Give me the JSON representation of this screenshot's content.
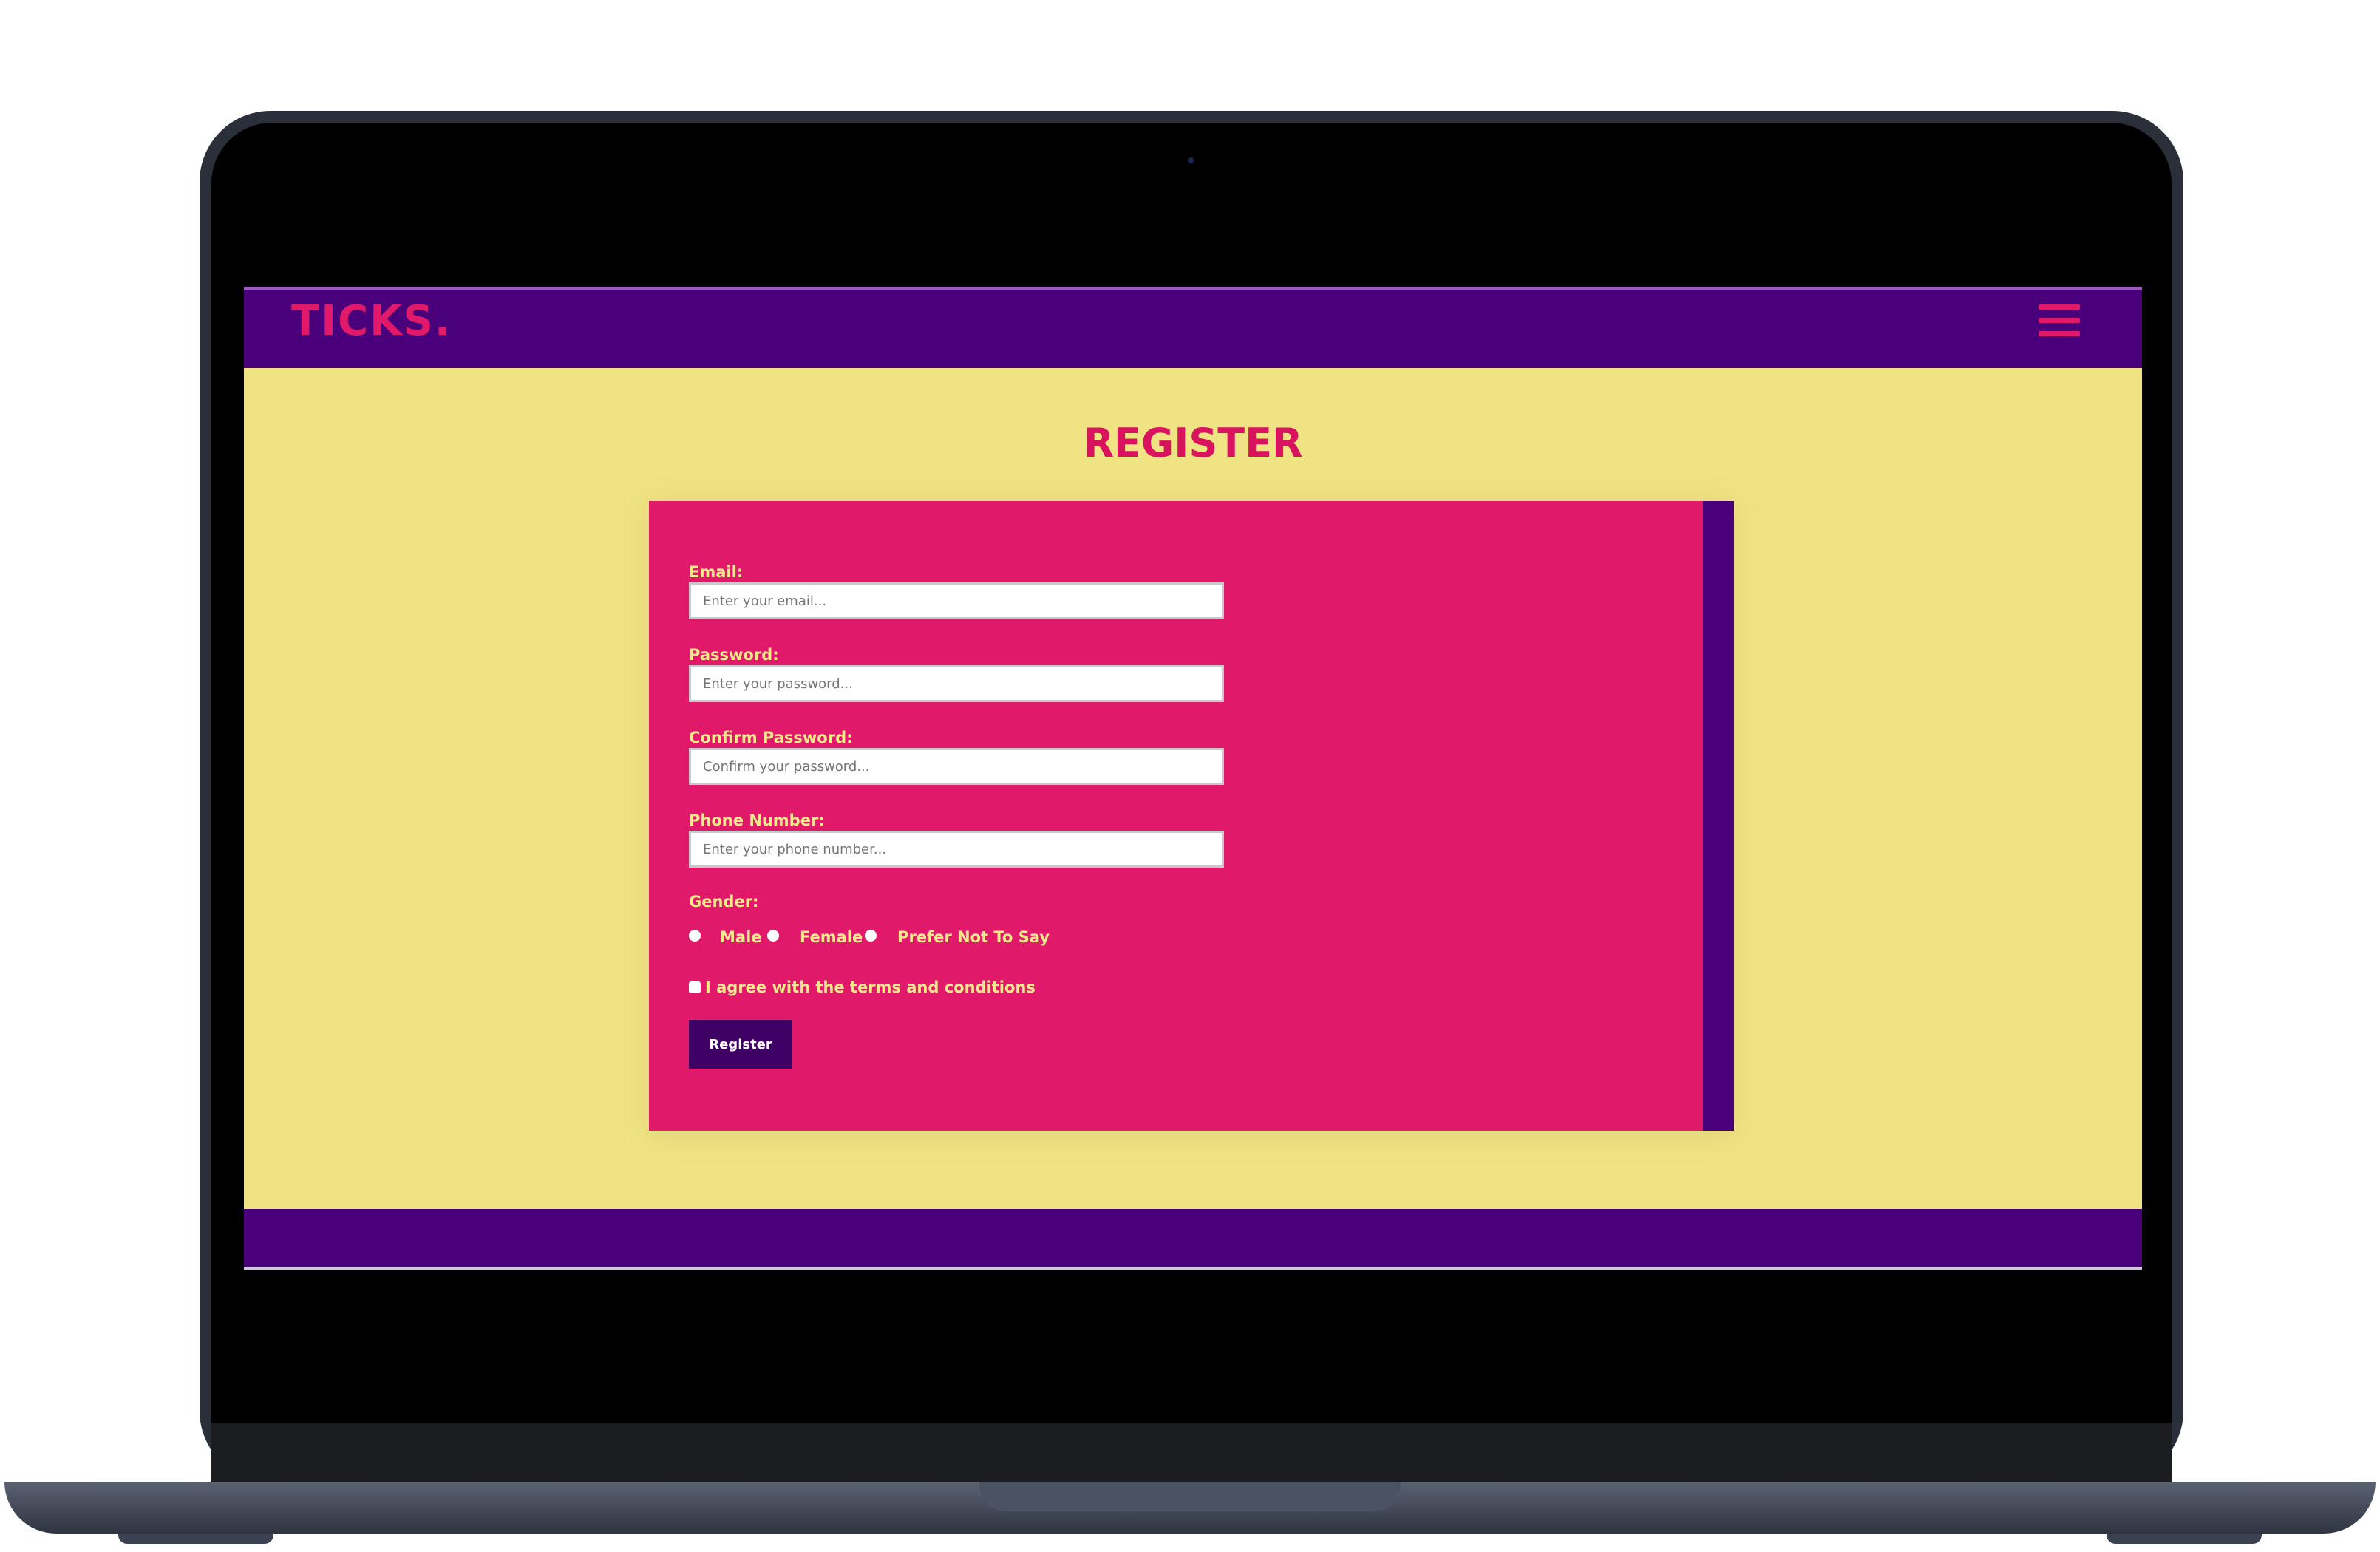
{
  "site": {
    "logo": "TICKS.",
    "menu_icon": "hamburger-menu-icon",
    "colors": {
      "nav_bg": "#4a007a",
      "page_bg": "#f0e383",
      "card_bg": "#e0196a",
      "accent": "#d9145e",
      "button_bg": "#3f0066"
    }
  },
  "page": {
    "title": "REGISTER"
  },
  "form": {
    "email": {
      "label": "Email:",
      "placeholder": "Enter your email..."
    },
    "password": {
      "label": "Password:",
      "placeholder": "Enter your password..."
    },
    "confirm_password": {
      "label": "Confirm Password:",
      "placeholder": "Confirm your password..."
    },
    "phone": {
      "label": "Phone Number:",
      "placeholder": "Enter your phone number..."
    },
    "gender": {
      "label": "Gender:",
      "options": [
        "Male",
        "Female",
        "Prefer Not To Say"
      ]
    },
    "terms_label": "I agree with the terms and conditions",
    "submit_label": "Register"
  }
}
